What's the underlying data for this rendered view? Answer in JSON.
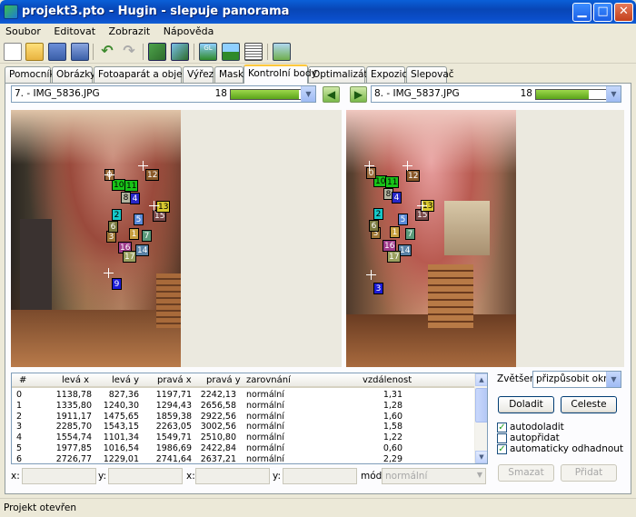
{
  "window": {
    "title": "projekt3.pto - Hugin - slepuje panorama"
  },
  "menu": [
    "Soubor",
    "Editovat",
    "Zobrazit",
    "Nápověda"
  ],
  "toolbar_icons": [
    "new-icon",
    "open-icon",
    "save-icon",
    "save-as-icon",
    "undo-icon",
    "redo-icon",
    "add-image-icon",
    "add-time-series-icon",
    "preview-gl-icon",
    "preview-icon",
    "properties-icon",
    "stitch-icon"
  ],
  "tabs": [
    "Pomocník",
    "Obrázky",
    "Fotoaparát a objektiv",
    "Výřez",
    "Maska",
    "Kontrolní body",
    "Optimalizátor",
    "Expozice",
    "Slepovač"
  ],
  "active_tab": "Kontrolní body",
  "left_image": {
    "label": "7. - IMG_5836.JPG",
    "count": "18",
    "progress": 0.82
  },
  "right_image": {
    "label": "8. - IMG_5837.JPG",
    "count": "18",
    "progress": 0.64
  },
  "control_points_left": [
    "10",
    "11",
    "12",
    "8",
    "4",
    "2",
    "5",
    "15",
    "3",
    "16",
    "14",
    "17",
    "9",
    "1",
    "6",
    "7",
    "0",
    "13"
  ],
  "control_points_right": [
    "10",
    "11",
    "12",
    "8",
    "4",
    "2",
    "5",
    "15",
    "3",
    "16",
    "14",
    "17",
    "3",
    "1",
    "6",
    "7",
    "0",
    "13"
  ],
  "table": {
    "headers": [
      "#",
      "levá x",
      "levá y",
      "pravá x",
      "pravá y",
      "zarovnání",
      "vzdálenost"
    ],
    "rows": [
      [
        "0",
        "1138,78",
        "827,36",
        "1197,71",
        "2242,13",
        "normální",
        "1,31"
      ],
      [
        "1",
        "1335,80",
        "1240,30",
        "1294,43",
        "2656,58",
        "normální",
        "1,28"
      ],
      [
        "2",
        "1911,17",
        "1475,65",
        "1859,38",
        "2922,56",
        "normální",
        "1,60"
      ],
      [
        "3",
        "2285,70",
        "1543,15",
        "2263,05",
        "3002,56",
        "normální",
        "1,58"
      ],
      [
        "4",
        "1554,74",
        "1101,34",
        "1549,71",
        "2510,80",
        "normální",
        "1,22"
      ],
      [
        "5",
        "1977,85",
        "1016,54",
        "1986,69",
        "2422,84",
        "normální",
        "0,60"
      ],
      [
        "6",
        "2726,77",
        "1229,01",
        "2741,64",
        "2637,21",
        "normální",
        "2,29"
      ]
    ]
  },
  "zoom": {
    "label": "Zvětšení:",
    "value": "přizpůsobit oknu"
  },
  "buttons": {
    "fine_tune": "Doladit",
    "whole": "Celeste",
    "delete": "Smazat",
    "add": "Přidat"
  },
  "checkboxes": [
    {
      "label": "autodoladit",
      "checked": true
    },
    {
      "label": "autopřidat",
      "checked": false
    },
    {
      "label": "automaticky odhadnout",
      "checked": true
    }
  ],
  "fields": {
    "x_left": "x:",
    "y_left": "y:",
    "x_right": "x:",
    "y_right": "y:",
    "mode_label": "mód:",
    "mode_value": "normální"
  },
  "status": "Projekt otevřen"
}
